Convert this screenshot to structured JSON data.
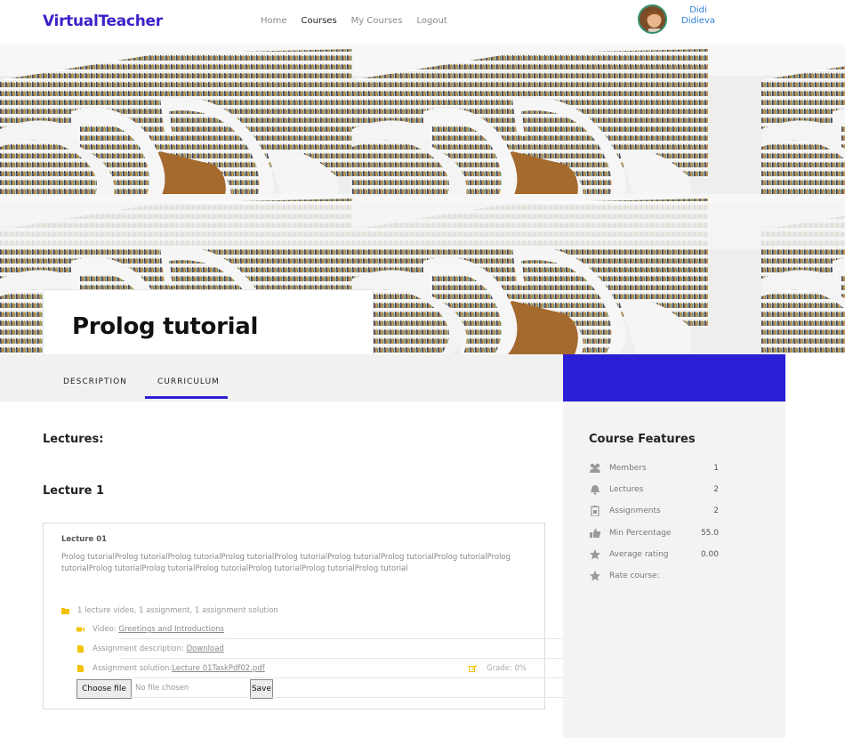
{
  "header": {
    "logo": "VirtualTeacher",
    "nav": [
      {
        "label": "Home"
      },
      {
        "label": "Courses"
      },
      {
        "label": "My Courses"
      },
      {
        "label": "Logout"
      }
    ],
    "user": {
      "first": "Didi",
      "last": "Didieva"
    }
  },
  "course": {
    "title": "Prolog tutorial"
  },
  "tabs": {
    "description": "DESCRIPTION",
    "curriculum": "CURRICULUM"
  },
  "main": {
    "lectures_heading": "Lectures:",
    "lecture_heading": "Lecture 1",
    "lecture": {
      "title": "Lecture 01",
      "description": "Prolog tutorialProlog tutorialProlog tutorialProlog tutorialProlog tutorialProlog tutorialProlog tutorialProlog tutorialProlog tutorialProlog tutorialProlog tutorialProlog tutorialProlog tutorialProlog tutorialProlog tutorial",
      "summary": "1 lecture video, 1 assignment, 1 assignment solution",
      "video_label": "Video: ",
      "video_link": "Greetings and Introductions",
      "assignment_label": "Assignment description: ",
      "assignment_link": "Download",
      "solution_label": "Assignment solution:",
      "solution_link": "Lecture 01TaskPdf02.pdf",
      "grade": "Grade: 0%",
      "choose_file": "Choose file",
      "no_file": "No file chosen",
      "save": "Save"
    }
  },
  "sidebar": {
    "heading": "Course Features",
    "features": [
      {
        "label": "Members",
        "value": "1",
        "icon": "users-icon"
      },
      {
        "label": "Lectures",
        "value": "2",
        "icon": "bell-icon"
      },
      {
        "label": "Assignments",
        "value": "2",
        "icon": "clipboard-icon"
      },
      {
        "label": "Min Percentage",
        "value": "55.0",
        "icon": "thumbs-up-icon"
      },
      {
        "label": "Average rating",
        "value": "0.00",
        "icon": "star-icon"
      },
      {
        "label": "Rate course:",
        "value": "",
        "icon": "star-icon"
      }
    ]
  },
  "colors": {
    "brand": "#3b22c9",
    "accent_block": "#2b1fd6",
    "folder_icon": "#f2c200",
    "user_link": "#2e7fd6"
  }
}
